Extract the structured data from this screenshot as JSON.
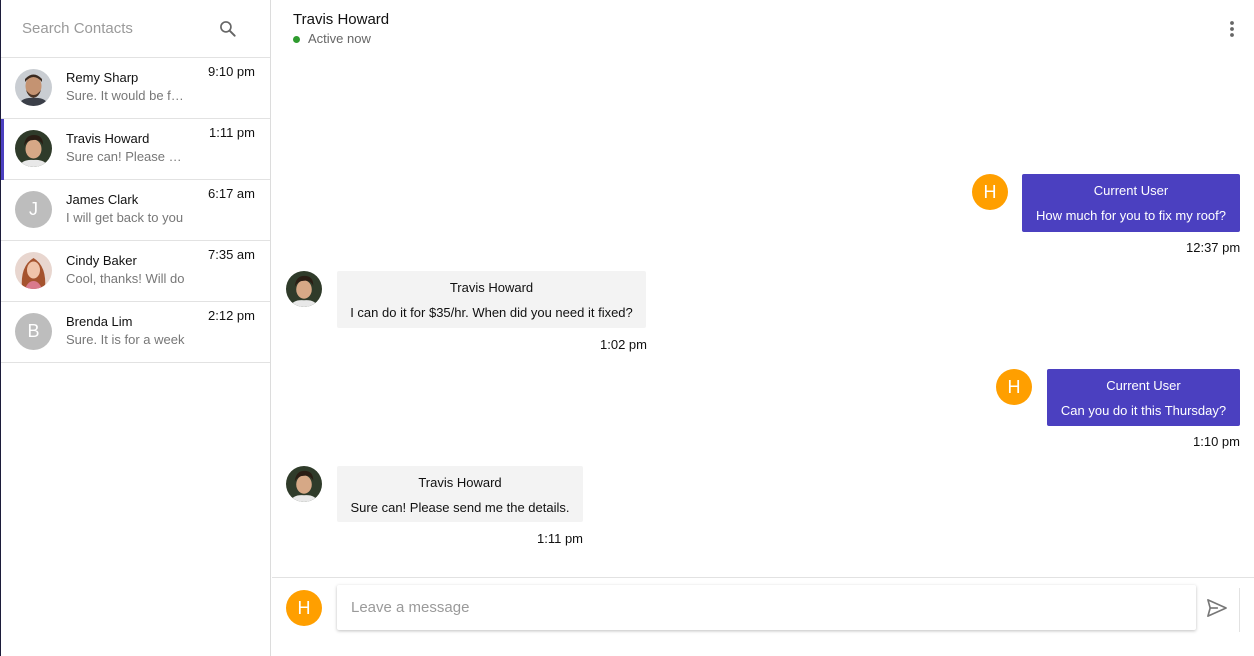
{
  "search": {
    "placeholder": "Search Contacts",
    "icon": "search-icon"
  },
  "contacts": [
    {
      "name": "Remy Sharp",
      "preview": "Sure. It would be for a roof",
      "time": "9:10 pm",
      "avatar": "photo"
    },
    {
      "name": "Travis Howard",
      "preview": "Sure can! Please send me the details.",
      "time": "1:11 pm",
      "avatar": "photo",
      "active": true
    },
    {
      "name": "James Clark",
      "preview": "I will get back to you",
      "time": "6:17 am",
      "avatar_letter": "J"
    },
    {
      "name": "Cindy Baker",
      "preview": "Cool, thanks! Will do",
      "time": "7:35 am",
      "avatar": "photo"
    },
    {
      "name": "Brenda Lim",
      "preview": "Sure. It is for a week",
      "time": "2:12 pm",
      "avatar_letter": "B"
    }
  ],
  "chat": {
    "title": "Travis Howard",
    "status": "Active now",
    "status_color": "#2e9b2e",
    "menu_icon": "more-vert-icon"
  },
  "messages": [
    {
      "sender": "Current User",
      "text": "How much for you to fix my roof?",
      "time": "12:37 pm",
      "direction": "out",
      "avatar_letter": "H"
    },
    {
      "sender": "Travis Howard",
      "text": "I can do it for $35/hr. When did you need it fixed?",
      "time": "1:02 pm",
      "direction": "in"
    },
    {
      "sender": "Current User",
      "text": "Can you do it this Thursday?",
      "time": "1:10 pm",
      "direction": "out",
      "avatar_letter": "H"
    },
    {
      "sender": "Travis Howard",
      "text": "Sure can! Please send me the details.",
      "time": "1:11 pm",
      "direction": "in"
    }
  ],
  "composer": {
    "placeholder": "Leave a message",
    "avatar_letter": "H",
    "send_icon": "send-icon"
  },
  "colors": {
    "accent": "#4b40c0",
    "user_avatar": "#ff9f00",
    "incoming_bubble": "#f3f3f3"
  }
}
